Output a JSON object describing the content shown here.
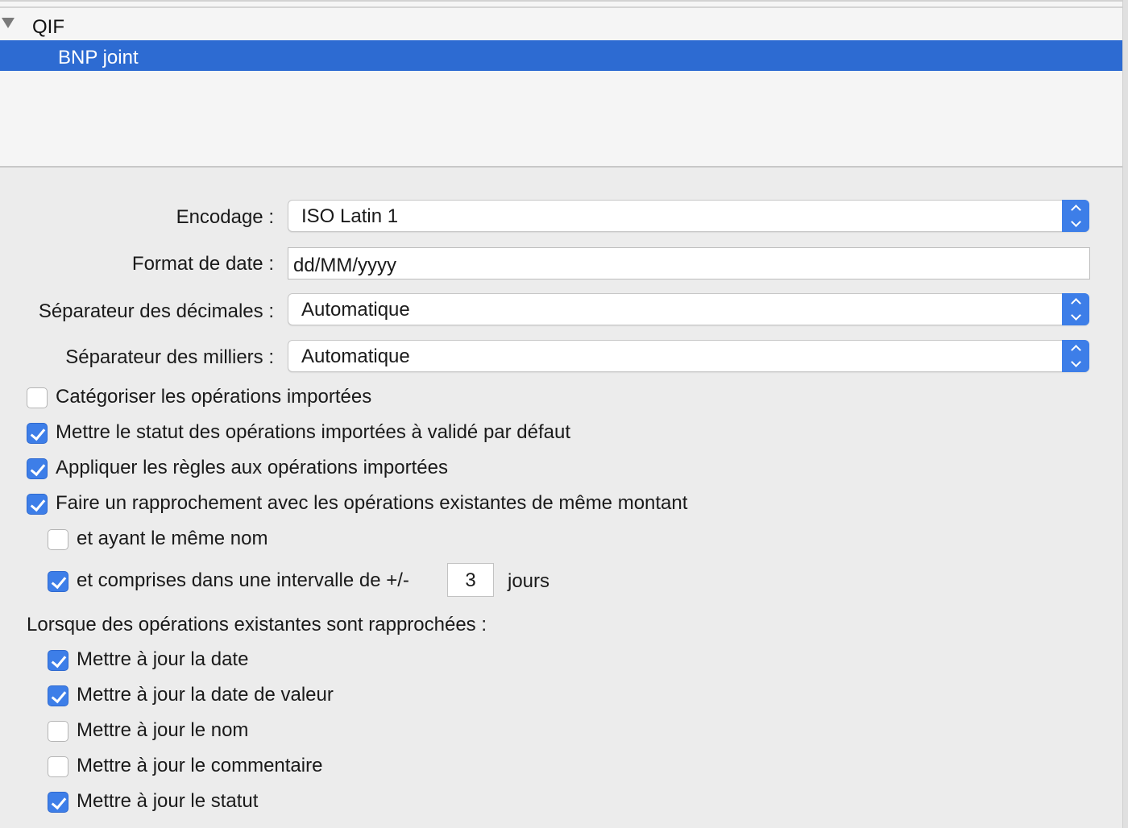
{
  "tree": {
    "group_label": "QIF",
    "selected_item": "BNP joint"
  },
  "form": {
    "encoding": {
      "label": "Encodage :",
      "value": "ISO Latin 1"
    },
    "date_format": {
      "label": "Format de date :",
      "value": "dd/MM/yyyy"
    },
    "decimal_separator": {
      "label": "Séparateur des décimales :",
      "value": "Automatique"
    },
    "thousands_separator": {
      "label": "Séparateur des milliers :",
      "value": "Automatique"
    }
  },
  "options": {
    "categorize": {
      "label": "Catégoriser les opérations importées",
      "checked": false
    },
    "validated_status": {
      "label": "Mettre le statut des opérations importées à validé par défaut",
      "checked": true
    },
    "apply_rules": {
      "label": "Appliquer les règles aux opérations importées",
      "checked": true
    },
    "reconcile": {
      "label": "Faire un rapprochement avec les opérations existantes de même montant",
      "checked": true
    },
    "same_name": {
      "label": "et ayant le même nom",
      "checked": false
    },
    "interval": {
      "label": "et comprises dans une intervalle de +/-",
      "checked": true,
      "days": "3",
      "unit": "jours"
    }
  },
  "reconciled": {
    "heading": "Lorsque des opérations existantes sont rapprochées :",
    "update_date": {
      "label": "Mettre à jour la date",
      "checked": true
    },
    "update_value_date": {
      "label": "Mettre à jour la date de valeur",
      "checked": true
    },
    "update_name": {
      "label": "Mettre à jour le nom",
      "checked": false
    },
    "update_comment": {
      "label": "Mettre à jour le commentaire",
      "checked": false
    },
    "update_status": {
      "label": "Mettre à jour le statut",
      "checked": true
    }
  }
}
